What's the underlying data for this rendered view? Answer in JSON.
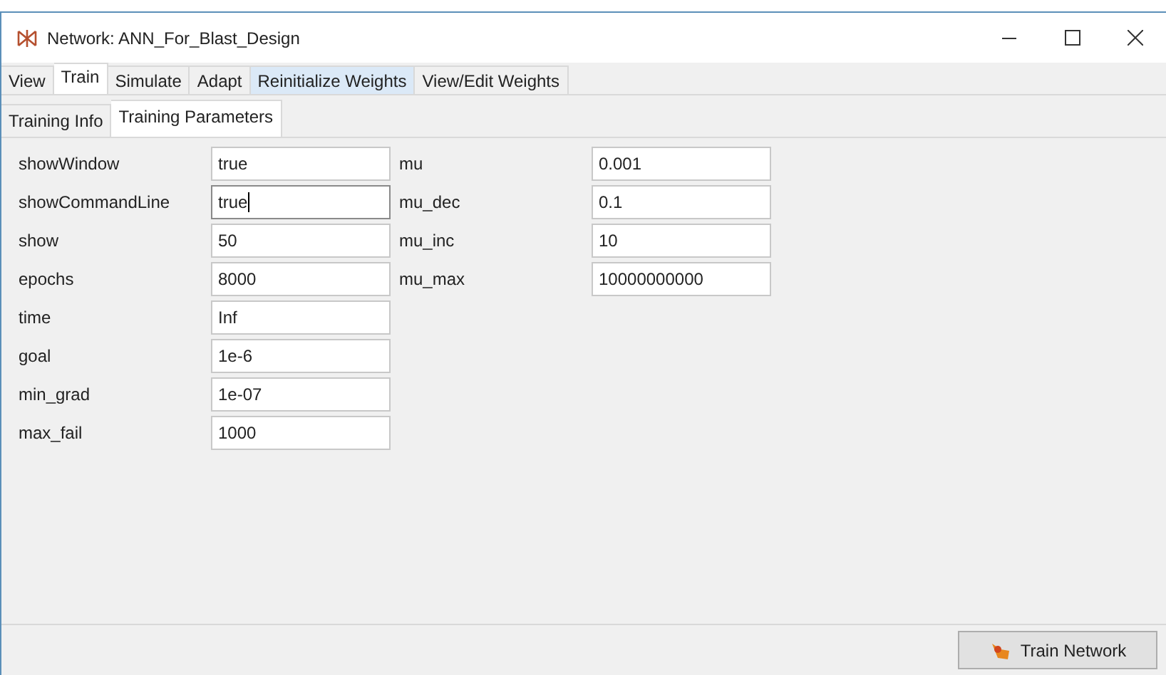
{
  "window": {
    "title": "Network: ANN_For_Blast_Design"
  },
  "tabs": [
    {
      "label": "View",
      "selected": false,
      "hovered": false
    },
    {
      "label": "Train",
      "selected": true,
      "hovered": false
    },
    {
      "label": "Simulate",
      "selected": false,
      "hovered": false
    },
    {
      "label": "Adapt",
      "selected": false,
      "hovered": false
    },
    {
      "label": "Reinitialize Weights",
      "selected": false,
      "hovered": true
    },
    {
      "label": "View/Edit Weights",
      "selected": false,
      "hovered": false
    }
  ],
  "subtabs": [
    {
      "label": "Training Info",
      "selected": false
    },
    {
      "label": "Training Parameters",
      "selected": true
    }
  ],
  "parameters_left": [
    {
      "label": "showWindow",
      "value": "true",
      "focused": false
    },
    {
      "label": "showCommandLine",
      "value": "true",
      "focused": true
    },
    {
      "label": "show",
      "value": "50",
      "focused": false
    },
    {
      "label": "epochs",
      "value": "8000",
      "focused": false
    },
    {
      "label": "time",
      "value": "Inf",
      "focused": false
    },
    {
      "label": "goal",
      "value": "1e-6",
      "focused": false
    },
    {
      "label": "min_grad",
      "value": "1e-07",
      "focused": false
    },
    {
      "label": "max_fail",
      "value": "1000",
      "focused": false
    }
  ],
  "parameters_right": [
    {
      "label": "mu",
      "value": "0.001",
      "focused": false
    },
    {
      "label": "mu_dec",
      "value": "0.1",
      "focused": false
    },
    {
      "label": "mu_inc",
      "value": "10",
      "focused": false
    },
    {
      "label": "mu_max",
      "value": "10000000000",
      "focused": false
    }
  ],
  "train_button": {
    "label": "Train Network"
  }
}
